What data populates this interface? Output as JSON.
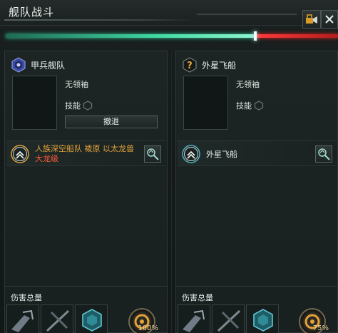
{
  "window": {
    "title": "舰队战斗"
  },
  "health": {
    "player_fraction": 0.75
  },
  "left_panel": {
    "fleet_name": "甲兵舰队",
    "commander": "无领袖",
    "skills_label": "技能",
    "retreat_label": "撤退",
    "ship": {
      "owner": "人族深空船队 袯原 以太龙兽",
      "class": "大龙级"
    },
    "damage_label": "伤害总量",
    "damage_percent": "100%"
  },
  "right_panel": {
    "fleet_name": "外星飞船",
    "commander": "无领袖",
    "skills_label": "技能",
    "ship": {
      "name": "外星飞船"
    },
    "damage_label": "伤害总量",
    "damage_percent": "75%"
  },
  "colors": {
    "accent_green": "#3fd9a4",
    "enemy_red": "#e22b2b",
    "owner_orange": "#e4a23a",
    "class_red": "#ff5a3c"
  },
  "icons": [
    "camera-lock-icon",
    "close-icon",
    "fleet-emblem-icon",
    "unknown-fleet-icon",
    "rank-chevron-icon",
    "inspect-icon",
    "hexagon-skill-icon",
    "weapon-icon",
    "damage-dial-icon"
  ]
}
